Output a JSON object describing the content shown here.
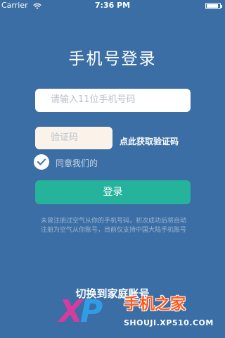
{
  "status_bar": {
    "carrier": "Carrier",
    "time": "7:36 PM"
  },
  "page": {
    "title": "手机号登录"
  },
  "form": {
    "phone_placeholder": "请输入11位手机号码",
    "code_placeholder": "验证码",
    "get_code_label": "点此获取验证码",
    "agree_prefix": "同意我们的",
    "agree_link": "",
    "agree_checked": true,
    "login_label": "登录",
    "notice": "未曾注册过空气从你的手机号码，初次成功后将自动注册为空气从你账号，目前仅支持中国大陆手机账号"
  },
  "footer": {
    "switch_label": "切换到家庭账号"
  },
  "watermark": {
    "logo": "XP",
    "name": "手机之家",
    "url": "SHOUJI.XP510.COM"
  },
  "colors": {
    "background": "#3a6ea5",
    "accent_green": "#26b39b",
    "link_blue": "#1f8ce6"
  },
  "icons": {
    "wifi": "wifi-icon",
    "battery": "battery-icon",
    "checkbox": "checkmark-icon"
  }
}
